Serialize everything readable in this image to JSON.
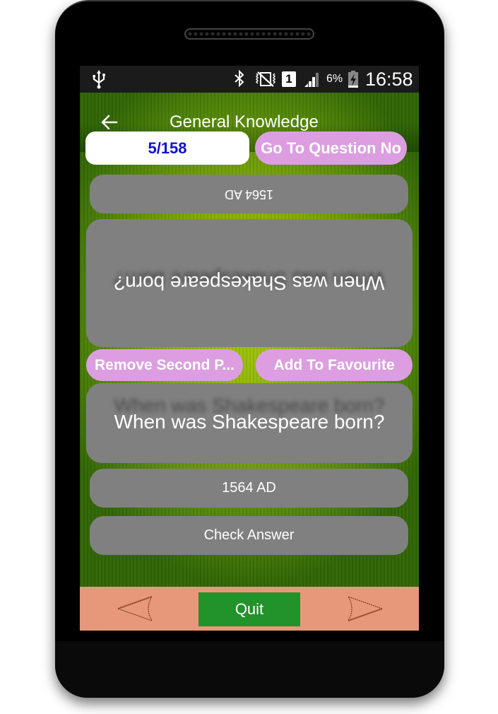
{
  "status_bar": {
    "battery_percent": "6%",
    "time": "16:58",
    "sim_slot": "1",
    "icons": [
      "usb-icon",
      "bluetooth-icon",
      "vibrate-off-icon",
      "sim-icon",
      "signal-icon",
      "battery-charging-icon"
    ]
  },
  "toolbar": {
    "title": "General Knowledge",
    "back_icon": "arrow-left-icon"
  },
  "quiz": {
    "counter": "5/158",
    "goto_label": "Go To Question No",
    "answer_flipped": "1564 AD",
    "question_flipped": "When was Shakespeare born?",
    "remove_label": "Remove Second P...",
    "favourite_label": "Add To Favourite",
    "question": "When was Shakespeare born?",
    "answer": "1564 AD",
    "check_label": "Check Answer"
  },
  "bottom_bar": {
    "prev_icon": "arrow-prev-icon",
    "quit_label": "Quit",
    "next_icon": "arrow-next-icon"
  },
  "colors": {
    "accent_pink": "#dc9ee0",
    "counter_text": "#1010d0",
    "card_grey": "#808080",
    "bottom_bar": "#e8987a",
    "quit_green": "#22922a"
  }
}
